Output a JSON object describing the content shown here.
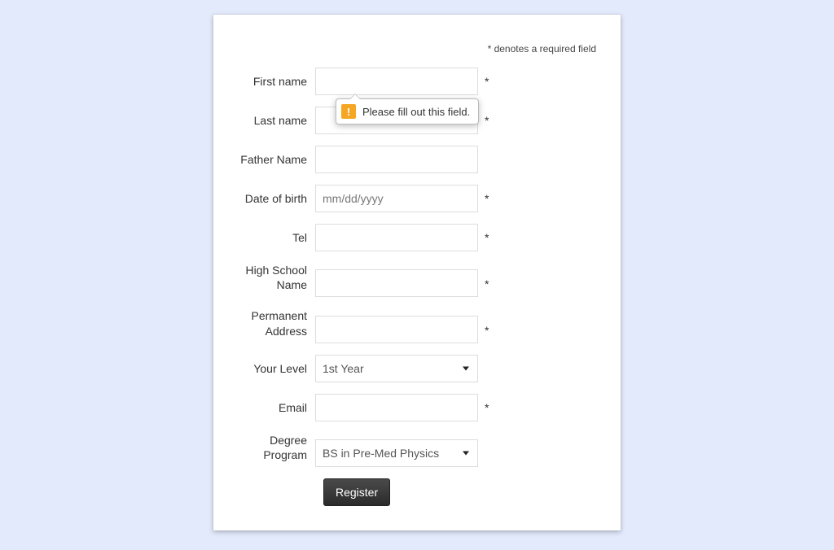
{
  "required_note": "* denotes a required field",
  "tooltip_text": "Please fill out this field.",
  "fields": {
    "first_name": {
      "label": "First name",
      "value": "",
      "required": true
    },
    "last_name": {
      "label": "Last name",
      "value": "",
      "required": true
    },
    "father_name": {
      "label": "Father Name",
      "value": "",
      "required": false
    },
    "dob": {
      "label": "Date of birth",
      "placeholder": "mm/dd/yyyy",
      "value": "",
      "required": true
    },
    "tel": {
      "label": "Tel",
      "value": "",
      "required": true
    },
    "high_school": {
      "label": "High School Name",
      "value": "",
      "required": true
    },
    "address": {
      "label": "Permanent Address",
      "value": "",
      "required": true
    },
    "level": {
      "label": "Your Level",
      "selected": "1st Year",
      "required": false
    },
    "email": {
      "label": "Email",
      "value": "",
      "required": true
    },
    "degree": {
      "label": "Degree Program",
      "selected": "BS in Pre-Med Physics",
      "required": false
    }
  },
  "buttons": {
    "register": "Register"
  },
  "star": "*"
}
